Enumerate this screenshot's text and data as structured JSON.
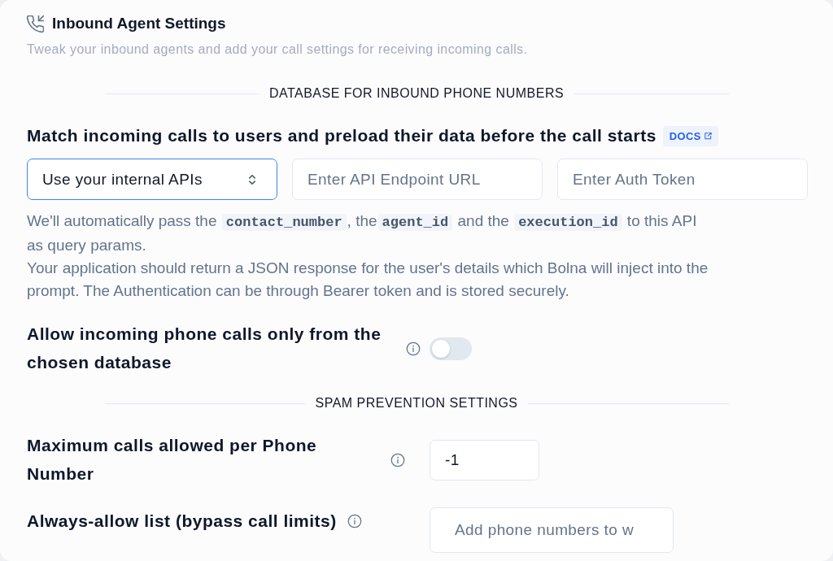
{
  "header": {
    "title": "Inbound Agent Settings",
    "subtitle": "Tweak your inbound agents and add your call settings for receiving incoming calls."
  },
  "database_section": {
    "divider": "DATABASE FOR INBOUND PHONE NUMBERS",
    "heading": "Match incoming calls to users and preload their data before the call starts",
    "docs_link": "DOCS",
    "source_select": {
      "value": "Use your internal APIs",
      "focused": true
    },
    "endpoint_field": {
      "placeholder": "Enter API Endpoint URL"
    },
    "token_field": {
      "placeholder": "Enter Auth Token"
    },
    "help_paragraphs": [
      [
        {
          "kind": "text",
          "text": "We'll automatically pass the "
        },
        {
          "kind": "code",
          "text": "contact_number"
        },
        {
          "kind": "text",
          "text": ", the"
        },
        {
          "kind": "code",
          "text": "agent_id"
        },
        {
          "kind": "text",
          "text": " and the "
        },
        {
          "kind": "code",
          "text": "execution_id"
        },
        {
          "kind": "text",
          "text": " to this API as query params."
        }
      ],
      [
        {
          "kind": "text",
          "text": "Your application should return a JSON response for the user's details which Bolna will inject into the prompt. The Authentication can be through Bearer token and is stored securely."
        }
      ]
    ],
    "settings": [
      {
        "kind": "toggle",
        "label": "Allow incoming phone calls only from the chosen database",
        "on": false
      }
    ]
  },
  "spam_section": {
    "divider": "SPAM PREVENTION SETTINGS",
    "settings": [
      {
        "kind": "number",
        "label": "Maximum calls allowed per Phone Number",
        "value": "-1"
      },
      {
        "kind": "tags",
        "label": "Always-allow list (bypass call limits)",
        "placeholder": "Add phone numbers to w"
      }
    ]
  }
}
